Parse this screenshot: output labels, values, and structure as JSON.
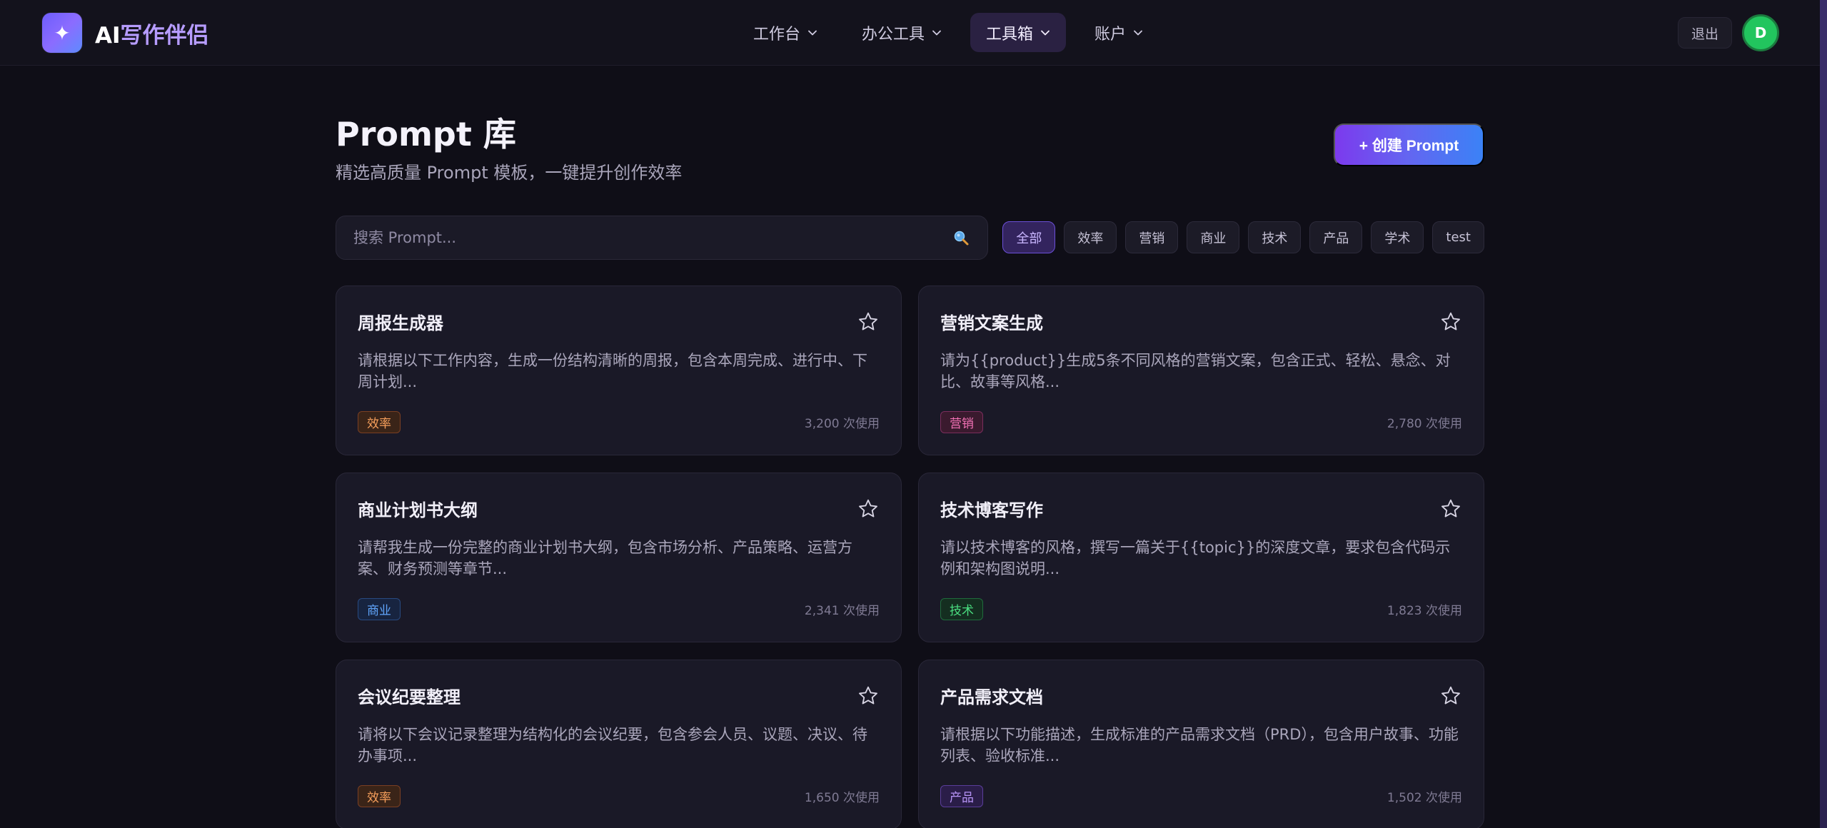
{
  "app": {
    "logo_prefix": "AI",
    "logo_suffix": "写作伴侣",
    "logo_glyph": "✦"
  },
  "nav": {
    "items": [
      {
        "label": "工作台"
      },
      {
        "label": "办公工具"
      },
      {
        "label": "工具箱",
        "active": true
      },
      {
        "label": "账户"
      }
    ],
    "logout_label": "退出",
    "avatar_initial": "D"
  },
  "page": {
    "title": "Prompt 库",
    "subtitle": "精选高质量 Prompt 模板，一键提升创作效率",
    "create_label": "+ 创建 Prompt"
  },
  "search": {
    "placeholder": "搜索 Prompt...",
    "value": ""
  },
  "filters": [
    {
      "label": "全部",
      "active": true
    },
    {
      "label": "效率"
    },
    {
      "label": "营销"
    },
    {
      "label": "商业"
    },
    {
      "label": "技术"
    },
    {
      "label": "产品"
    },
    {
      "label": "学术"
    },
    {
      "label": "test"
    }
  ],
  "cards": [
    {
      "title": "周报生成器",
      "desc": "请根据以下工作内容，生成一份结构清晰的周报，包含本周完成、进行中、下周计划...",
      "tag": "效率",
      "usage": "3,200 次使用"
    },
    {
      "title": "营销文案生成",
      "desc": "请为{{product}}生成5条不同风格的营销文案，包含正式、轻松、悬念、对比、故事等风格...",
      "tag": "营销",
      "usage": "2,780 次使用"
    },
    {
      "title": "商业计划书大纲",
      "desc": "请帮我生成一份完整的商业计划书大纲，包含市场分析、产品策略、运营方案、财务预测等章节...",
      "tag": "商业",
      "usage": "2,341 次使用"
    },
    {
      "title": "技术博客写作",
      "desc": "请以技术博客的风格，撰写一篇关于{{topic}}的深度文章，要求包含代码示例和架构图说明...",
      "tag": "技术",
      "usage": "1,823 次使用"
    },
    {
      "title": "会议纪要整理",
      "desc": "请将以下会议记录整理为结构化的会议纪要，包含参会人员、议题、决议、待办事项...",
      "tag": "效率",
      "usage": "1,650 次使用"
    },
    {
      "title": "产品需求文档",
      "desc": "请根据以下功能描述，生成标准的产品需求文档（PRD），包含用户故事、功能列表、验收标准...",
      "tag": "产品",
      "usage": "1,502 次使用"
    }
  ],
  "tag_colors": {
    "效率": {
      "fg": "#f59e5b",
      "bg": "#3a2418",
      "border": "#7a3f22"
    },
    "营销": {
      "fg": "#f472b6",
      "bg": "#3a1a2e",
      "border": "#7a2d5c"
    },
    "商业": {
      "fg": "#60a5fa",
      "bg": "#172440",
      "border": "#284a80"
    },
    "技术": {
      "fg": "#4ade80",
      "bg": "#142e20",
      "border": "#1f6b3c"
    },
    "产品": {
      "fg": "#b794f6",
      "bg": "#2a1d48",
      "border": "#5a3d9a"
    }
  }
}
